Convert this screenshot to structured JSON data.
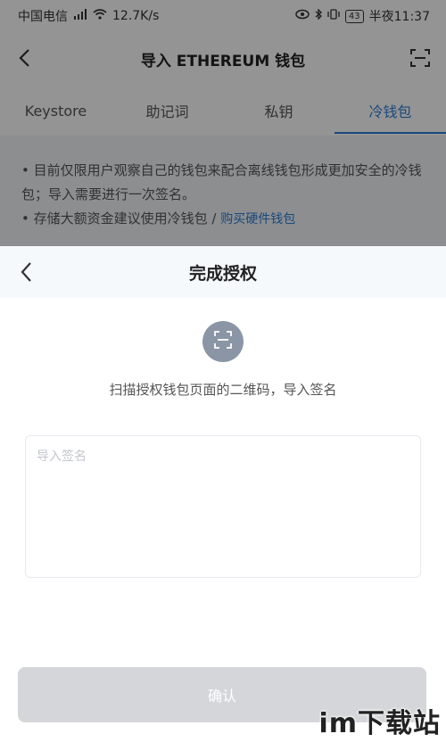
{
  "status_bar": {
    "carrier": "中国电信",
    "net_speed": "12.7K/s",
    "battery": "43",
    "time": "半夜11:37"
  },
  "header": {
    "title": "导入 ETHEREUM 钱包"
  },
  "tabs": [
    {
      "label": "Keystore"
    },
    {
      "label": "助记词"
    },
    {
      "label": "私钥"
    },
    {
      "label": "冷钱包"
    }
  ],
  "notes": {
    "line1": "• 目前仅限用户观察自己的钱包来配合离线钱包形成更加安全的冷钱包；导入需要进行一次签名。",
    "line2": "• 存储大额资金建议使用冷钱包 / ",
    "link": "购买硬件钱包"
  },
  "sheet": {
    "title": "完成授权",
    "scan_hint": "扫描授权钱包页面的二维码，导入签名",
    "input_placeholder": "导入签名",
    "confirm_label": "确认"
  },
  "watermark": "im下载站",
  "colors": {
    "accent": "#2e7ed6",
    "disabled_button": "#d4d6d9",
    "scan_circle": "#8a96a6"
  }
}
